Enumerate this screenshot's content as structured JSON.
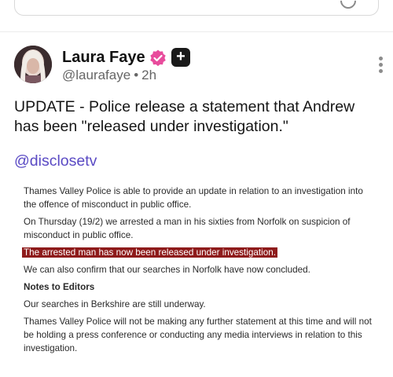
{
  "post": {
    "author_name": "Laura Faye",
    "handle": "@laurafaye",
    "separator": "•",
    "time": "2h",
    "plus_badge": "+",
    "text": "UPDATE - Police release a statement that Andrew has been \"released under investigation.\"",
    "mention": "@disclosetv"
  },
  "statement": {
    "p1": "Thames Valley Police is able to provide an update in relation to an investigation into the offence of misconduct in public office.",
    "p2": "On Thursday (19/2) we arrested a man in his sixties from Norfolk on suspicion of misconduct in public office.",
    "p3_highlight": "The arrested man has now been released under investigation.",
    "p4": "We can also confirm that our searches in Norfolk have now concluded.",
    "p5_heading": "Notes to Editors",
    "p6": "Our searches in Berkshire are still underway.",
    "p7": "Thames Valley Police will not be making any further statement at this time and will not be holding a press conference or conducting any media interviews in relation to this investigation."
  },
  "colors": {
    "verified_badge": "#e84c9c",
    "mention": "#5a4ac4",
    "highlight_bg": "#8e1b1b"
  },
  "icons": {
    "verified": "verified-badge-icon",
    "plus": "plus-subscription-icon",
    "more": "more-vertical-icon"
  }
}
